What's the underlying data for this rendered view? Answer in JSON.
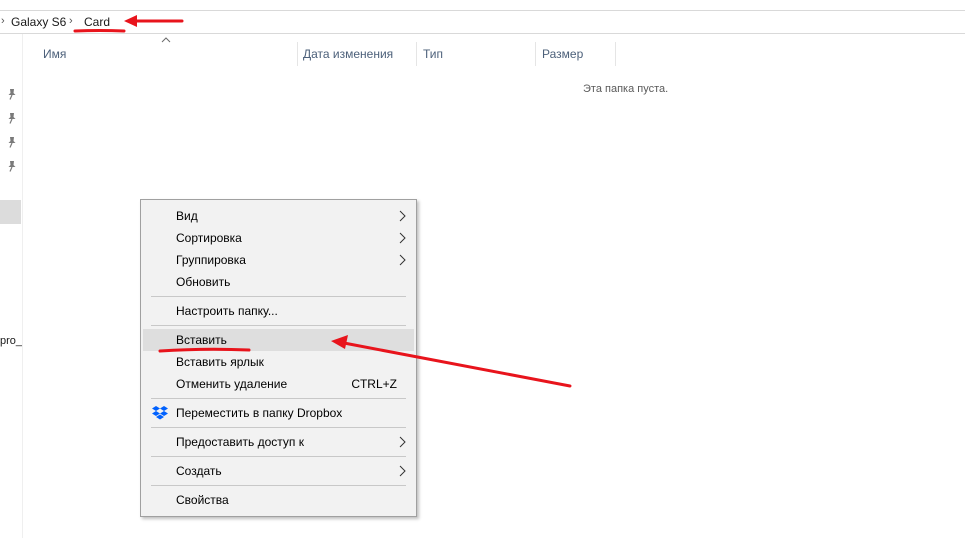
{
  "breadcrumb": {
    "items": [
      "Galaxy S6",
      "Card"
    ],
    "separator": "›"
  },
  "columns": [
    "Имя",
    "Дата изменения",
    "Тип",
    "Размер"
  ],
  "empty_message": "Эта папка пуста.",
  "nav": {
    "truncated_label": "pro_"
  },
  "context_menu": {
    "items": [
      {
        "label": "Вид",
        "submenu": true
      },
      {
        "label": "Сортировка",
        "submenu": true
      },
      {
        "label": "Группировка",
        "submenu": true
      },
      {
        "label": "Обновить"
      },
      {
        "label": "Настроить папку..."
      },
      {
        "label": "Вставить",
        "highlighted": true
      },
      {
        "label": "Вставить ярлык"
      },
      {
        "label": "Отменить удаление",
        "shortcut": "CTRL+Z"
      },
      {
        "label": "Переместить в папку Dropbox",
        "icon": "dropbox-icon"
      },
      {
        "label": "Предоставить доступ к",
        "submenu": true
      },
      {
        "label": "Создать",
        "submenu": true
      },
      {
        "label": "Свойства"
      }
    ]
  },
  "colors": {
    "annotation": "#e8141c",
    "column_header": "#4c607a",
    "highlight": "#dedede",
    "dropbox": "#0061fe"
  }
}
